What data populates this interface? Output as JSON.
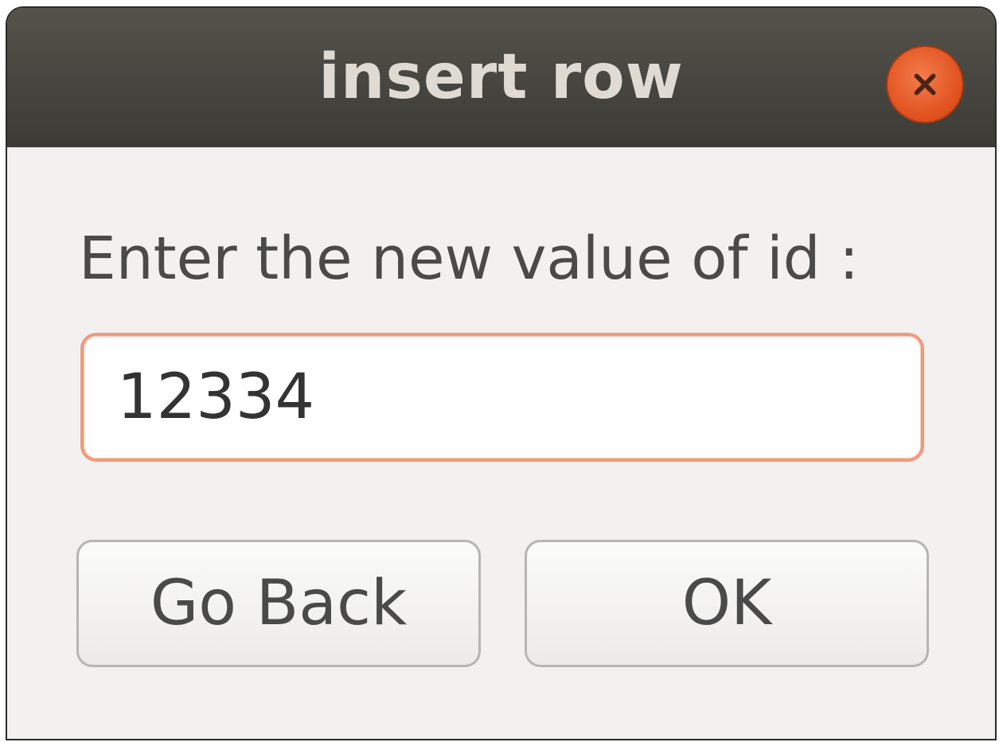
{
  "dialog": {
    "title": "insert row",
    "close_icon": "close-icon",
    "prompt_label": "Enter the new value of id :",
    "id_input": {
      "value": "12334"
    },
    "buttons": {
      "back_label": "Go Back",
      "ok_label": "OK"
    }
  },
  "colors": {
    "titlebar": "#3c3b36",
    "close_button": "#df4f1c",
    "focus_border": "#ee9b7d",
    "dialog_background": "#f2f1f0"
  }
}
